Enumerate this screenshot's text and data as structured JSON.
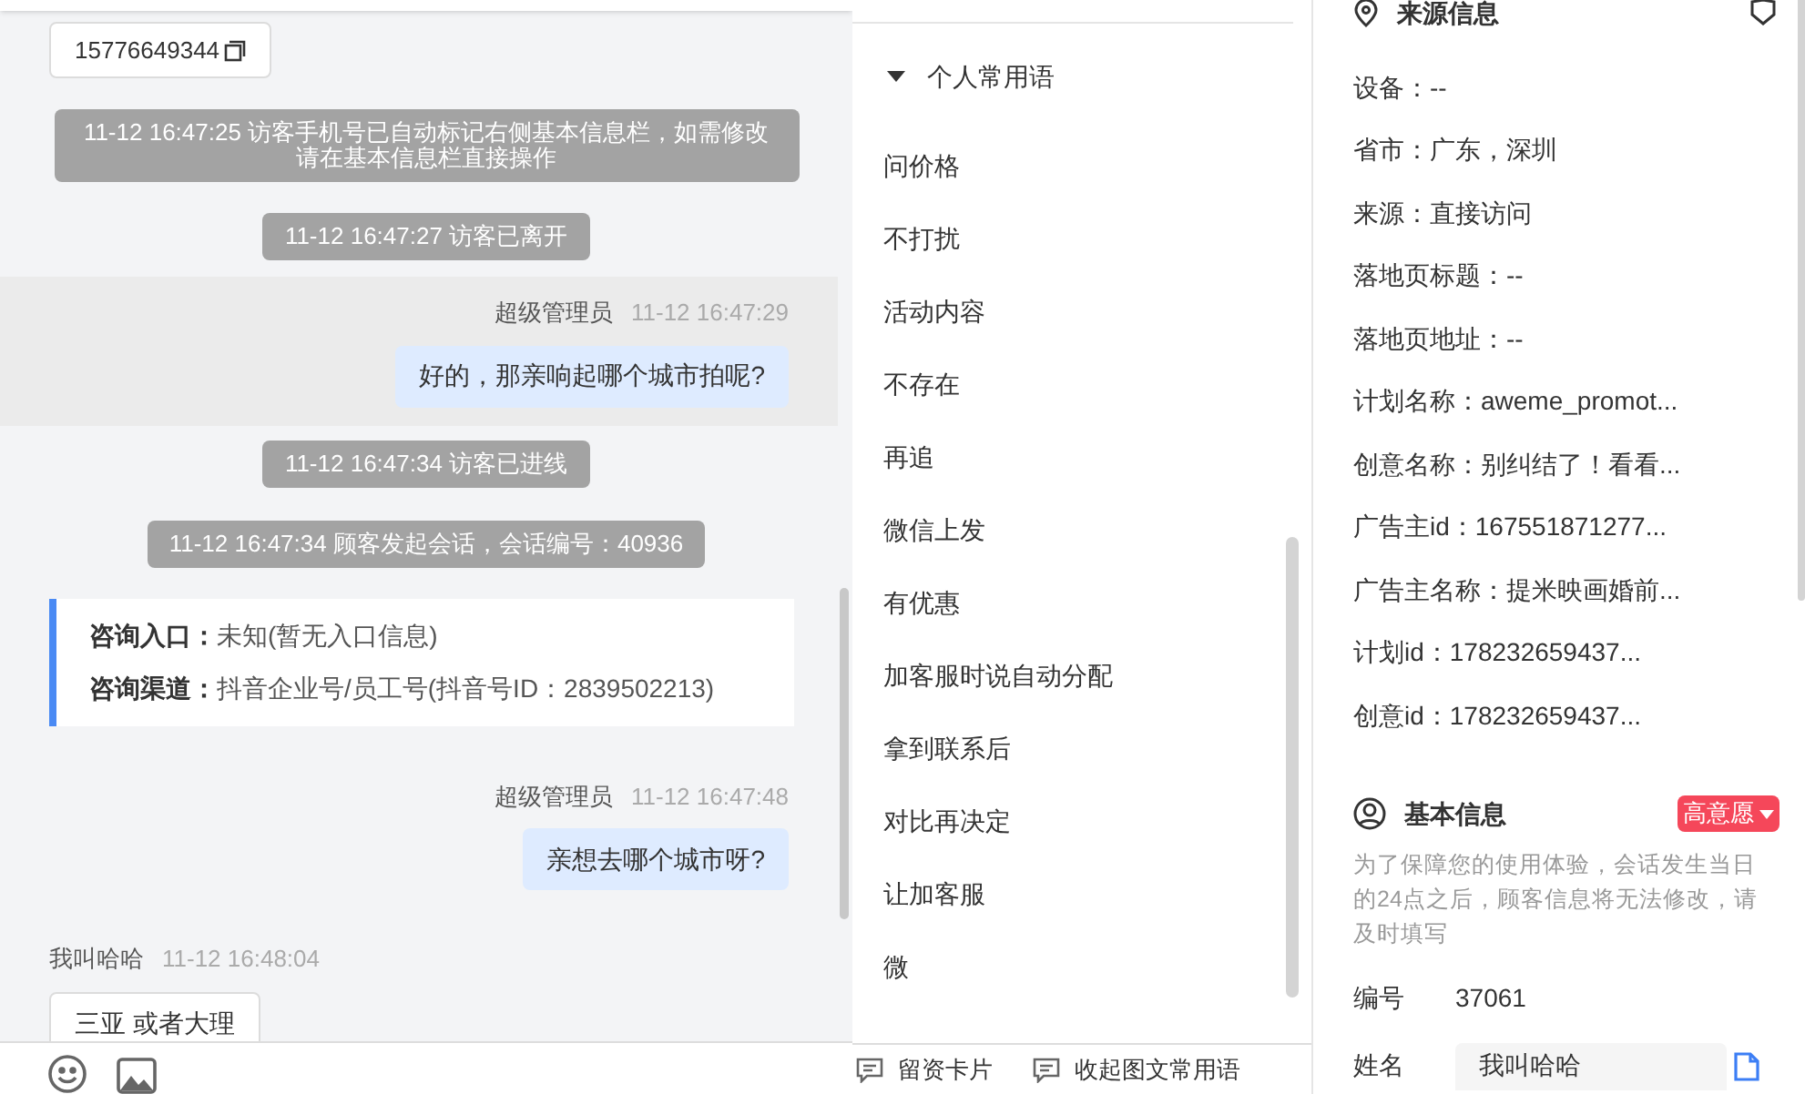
{
  "chat": {
    "messages": [
      {
        "kind": "phone",
        "text": "15776649344"
      },
      {
        "kind": "system",
        "text": "11-12 16:47:25 访客手机号已自动标记右侧基本信息栏，如需修改请在基本信息栏直接操作"
      },
      {
        "kind": "system",
        "text": "11-12 16:47:27 访客已离开"
      },
      {
        "kind": "agent",
        "sender": "超级管理员",
        "time": "11-12 16:47:29",
        "text": "好的，那亲响起哪个城市拍呢?",
        "highlighted": true
      },
      {
        "kind": "system",
        "text": "11-12 16:47:34 访客已进线"
      },
      {
        "kind": "system",
        "text": "11-12 16:47:34 顾客发起会话，会话编号：40936"
      },
      {
        "kind": "entry_info",
        "fields": [
          {
            "label": "咨询入口：",
            "value": "未知(暂无入口信息)"
          },
          {
            "label": "咨询渠道：",
            "value": "抖音企业号/员工号(抖音号ID：2839502213)"
          }
        ]
      },
      {
        "kind": "agent",
        "sender": "超级管理员",
        "time": "11-12 16:47:48",
        "text": "亲想去哪个城市呀?",
        "highlighted": false
      },
      {
        "kind": "customer",
        "sender": "我叫哈哈",
        "time": "11-12 16:48:04",
        "text": "三亚 或者大理"
      }
    ]
  },
  "quick_replies": {
    "group": "个人常用语",
    "expanded": true,
    "items": [
      "问价格",
      "不打扰",
      "活动内容",
      "不存在",
      "再追",
      "微信上发",
      "有优惠",
      "加客服时说自动分配",
      "拿到联系后",
      "对比再决定",
      "让加客服",
      "微"
    ],
    "actions": [
      "留资卡片",
      "收起图文常用语"
    ]
  },
  "source_info": {
    "title": "来源信息",
    "rows": [
      "设备：--",
      "省市：广东，深圳",
      "来源：直接访问",
      "落地页标题：--",
      "落地页地址：--",
      "计划名称：aweme_promot...",
      "创意名称：别纠结了！看看...",
      "广告主id：167551871277...",
      "广告主名称：提米映画婚前...",
      "计划id：178232659437...",
      "创意id：178232659437..."
    ]
  },
  "basic_info": {
    "title": "基本信息",
    "intent_tag": "高意愿",
    "note": "为了保障您的使用体验，会话发生当日的24点之后，顾客信息将无法修改，请及时填写",
    "fields": [
      {
        "kind": "text",
        "label": "编号",
        "value": "37061"
      },
      {
        "kind": "input",
        "label": "姓名",
        "value": "我叫哈哈"
      }
    ]
  }
}
